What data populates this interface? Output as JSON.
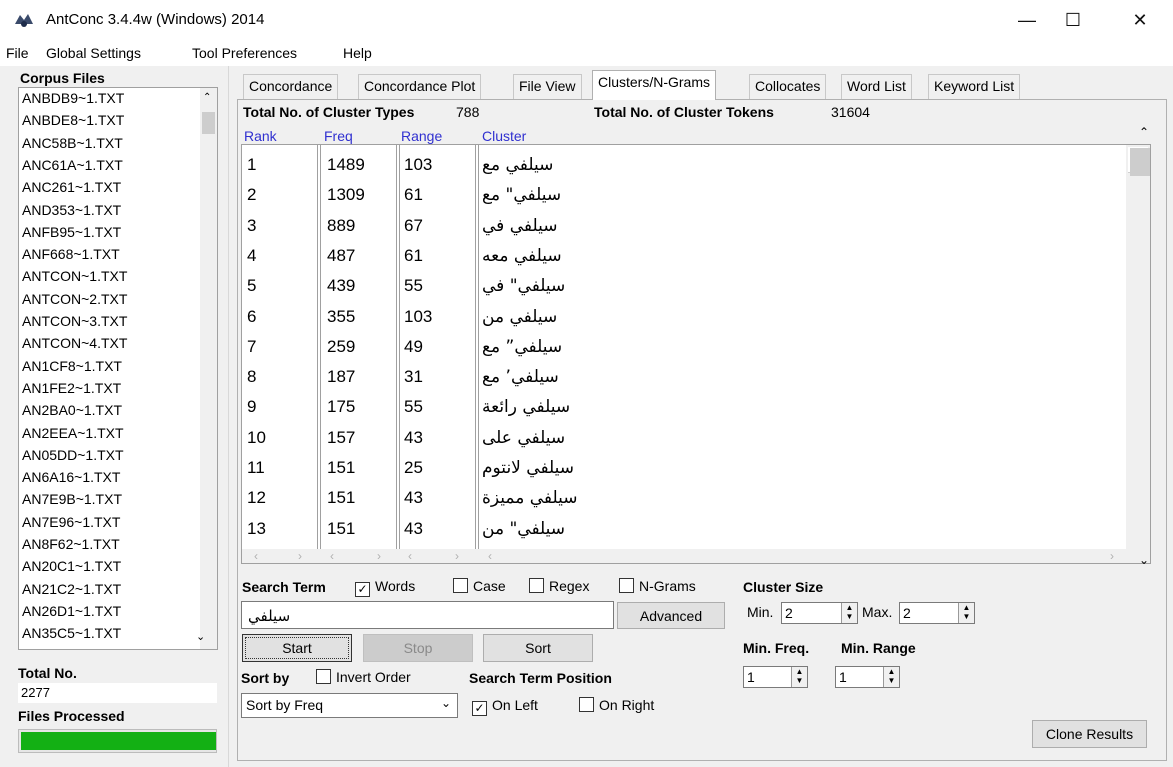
{
  "window": {
    "title": "AntConc 3.4.4w (Windows) 2014",
    "minimize": "—",
    "maximize": "☐",
    "close": "✕"
  },
  "menu": [
    "File",
    "Global Settings",
    "Tool Preferences",
    "Help"
  ],
  "left": {
    "corpus_files_label": "Corpus Files",
    "files": [
      "ANBDB9~1.TXT",
      "ANBDE8~1.TXT",
      "ANC58B~1.TXT",
      "ANC61A~1.TXT",
      "ANC261~1.TXT",
      "AND353~1.TXT",
      "ANFB95~1.TXT",
      "ANF668~1.TXT",
      "ANTCON~1.TXT",
      "ANTCON~2.TXT",
      "ANTCON~3.TXT",
      "ANTCON~4.TXT",
      "AN1CF8~1.TXT",
      "AN1FE2~1.TXT",
      "AN2BA0~1.TXT",
      "AN2EEA~1.TXT",
      "AN05DD~1.TXT",
      "AN6A16~1.TXT",
      "AN7E9B~1.TXT",
      "AN7E96~1.TXT",
      "AN8F62~1.TXT",
      "AN20C1~1.TXT",
      "AN21C2~1.TXT",
      "AN26D1~1.TXT",
      "AN35C5~1.TXT"
    ],
    "total_no_label": "Total No.",
    "total_no_value": "2277",
    "files_processed_label": "Files Processed",
    "progress": 1.0,
    "progress_color": "#13b014"
  },
  "tabs": [
    "Concordance",
    "Concordance Plot",
    "File View",
    "Clusters/N-Grams",
    "Collocates",
    "Word List",
    "Keyword List"
  ],
  "active_tab": "Clusters/N-Grams",
  "stats": {
    "types_label": "Total No. of Cluster Types",
    "types_value": "788",
    "tokens_label": "Total No. of Cluster Tokens",
    "tokens_value": "31604"
  },
  "columns": {
    "rank": "Rank",
    "freq": "Freq",
    "range": "Range",
    "cluster": "Cluster"
  },
  "rows": [
    {
      "rank": "1",
      "freq": "1489",
      "range": "103",
      "cluster": "سيلفي مع"
    },
    {
      "rank": "2",
      "freq": "1309",
      "range": "61",
      "cluster": "سيلفي\" مع"
    },
    {
      "rank": "3",
      "freq": "889",
      "range": "67",
      "cluster": "سيلفي في"
    },
    {
      "rank": "4",
      "freq": "487",
      "range": "61",
      "cluster": "سيلفي معه"
    },
    {
      "rank": "5",
      "freq": "439",
      "range": "55",
      "cluster": "سيلفي\" في"
    },
    {
      "rank": "6",
      "freq": "355",
      "range": "103",
      "cluster": "سيلفي من"
    },
    {
      "rank": "7",
      "freq": "259",
      "range": "49",
      "cluster": "سيلفي” مع"
    },
    {
      "rank": "8",
      "freq": "187",
      "range": "31",
      "cluster": "سيلفي’ مع"
    },
    {
      "rank": "9",
      "freq": "175",
      "range": "55",
      "cluster": "سيلفي رائعة"
    },
    {
      "rank": "10",
      "freq": "157",
      "range": "43",
      "cluster": "سيلفي على"
    },
    {
      "rank": "11",
      "freq": "151",
      "range": "25",
      "cluster": "سيلفي لانتوم"
    },
    {
      "rank": "12",
      "freq": "151",
      "range": "43",
      "cluster": "سيلفي مميزة"
    },
    {
      "rank": "13",
      "freq": "151",
      "range": "43",
      "cluster": "سيلفي\" من"
    }
  ],
  "search": {
    "label": "Search Term",
    "words": "Words",
    "words_checked": true,
    "case": "Case",
    "regex": "Regex",
    "ngrams": "N-Grams",
    "value": "سيلفي",
    "advanced": "Advanced",
    "start": "Start",
    "stop": "Stop",
    "sort": "Sort"
  },
  "cluster_size": {
    "label": "Cluster Size",
    "min_label": "Min.",
    "min_value": "2",
    "max_label": "Max.",
    "max_value": "2"
  },
  "min_freq": {
    "label": "Min. Freq.",
    "value": "1"
  },
  "min_range": {
    "label": "Min. Range",
    "value": "1"
  },
  "sort_by": {
    "label": "Sort by",
    "invert": "Invert Order",
    "selected": "Sort by Freq"
  },
  "position": {
    "label": "Search Term Position",
    "on_left": "On Left",
    "on_left_checked": true,
    "on_right": "On Right"
  },
  "clone": "Clone Results"
}
